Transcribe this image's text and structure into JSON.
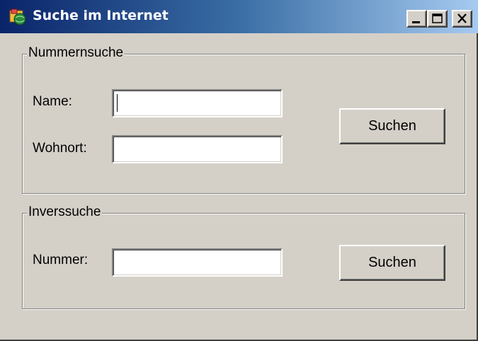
{
  "window": {
    "title": "Suche im Internet",
    "controls": [
      "minimize",
      "maximize",
      "close"
    ]
  },
  "number_search": {
    "legend": "Nummernsuche",
    "name_label": "Name:",
    "name_value": "",
    "city_label": "Wohnort:",
    "city_value": "",
    "search_button": "Suchen"
  },
  "inverse_search": {
    "legend": "Inverssuche",
    "number_label": "Nummer:",
    "number_value": "",
    "search_button": "Suchen"
  },
  "colors": {
    "titlebar_start": "#0a246a",
    "titlebar_end": "#a6caf0",
    "face": "#d4d0c8"
  },
  "icons": {
    "app": "app-globe-icon",
    "minimize": "minimize-icon",
    "maximize": "maximize-icon",
    "close": "close-icon"
  }
}
